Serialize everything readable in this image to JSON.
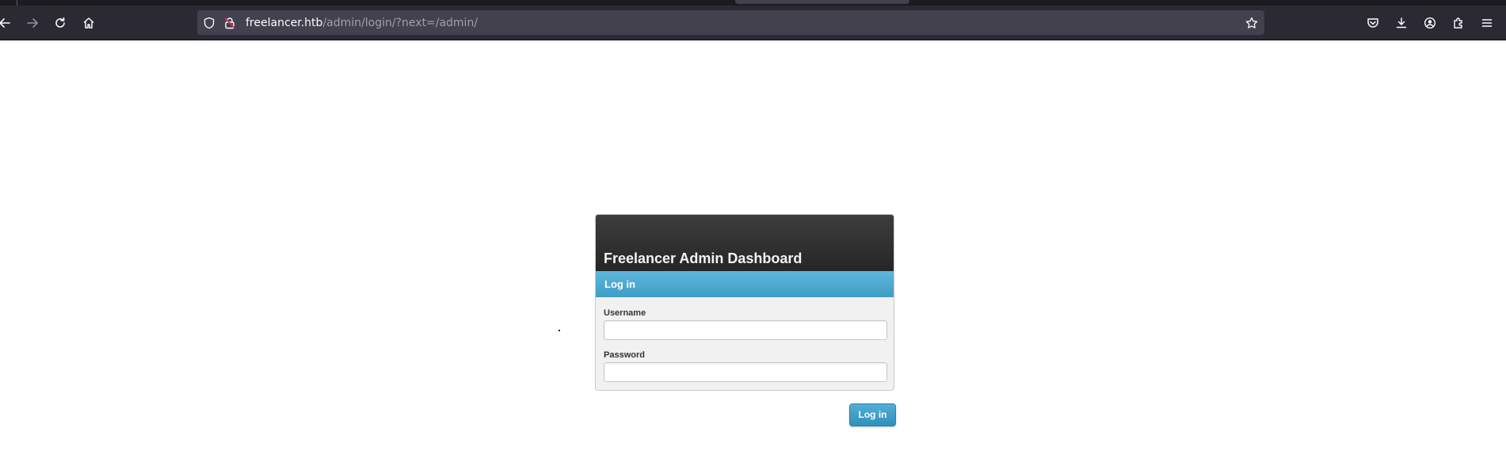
{
  "browser": {
    "url_host": "freelancer.htb",
    "url_path": "/admin/login/?next=/admin/",
    "icons": {
      "back": "back-arrow-icon",
      "forward": "forward-arrow-icon",
      "reload": "reload-icon",
      "home": "home-icon",
      "shield": "tracking-protection-shield-icon",
      "lock": "insecure-lock-icon",
      "bookmark": "bookmark-star-icon",
      "pocket": "pocket-icon",
      "downloads": "download-icon",
      "account": "account-icon",
      "extensions": "extensions-puzzle-icon",
      "menu": "hamburger-menu-icon"
    }
  },
  "login": {
    "site_title": "Freelancer Admin Dashboard",
    "section_title": "Log in",
    "username_label": "Username",
    "username_value": "",
    "password_label": "Password",
    "password_value": "",
    "submit_label": "Log in"
  },
  "colors": {
    "header_dark": "#2b2b2b",
    "accent_blue": "#3e9ec6",
    "toolbar": "#2b2a33"
  }
}
